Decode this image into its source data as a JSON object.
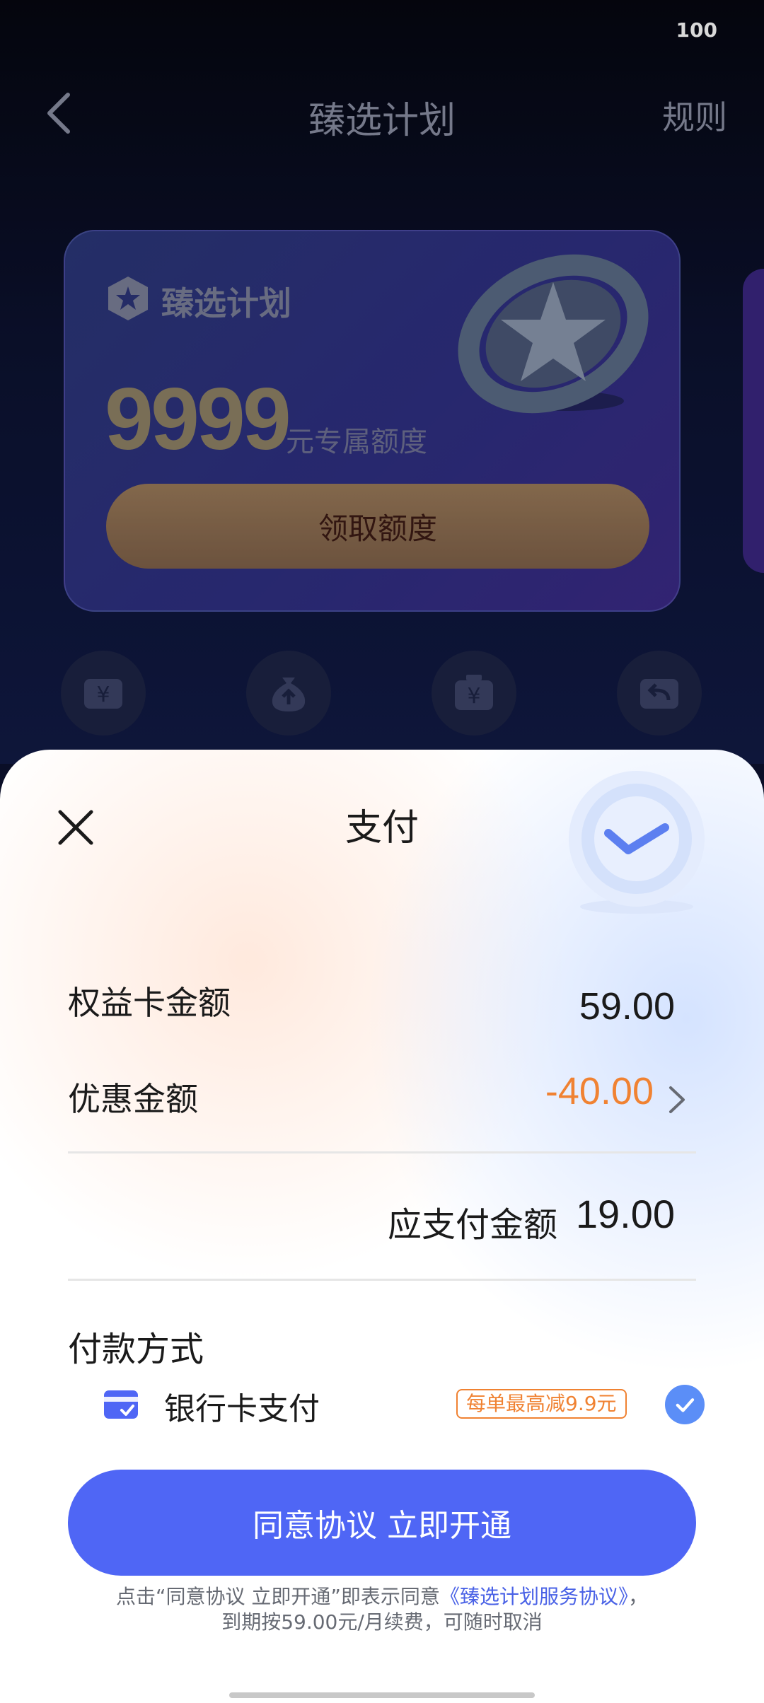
{
  "status_bar": {
    "battery": "100"
  },
  "nav": {
    "title": "臻选计划",
    "rules": "规则"
  },
  "plan_card": {
    "name": "臻选计划",
    "amount": "9999",
    "unit": "元专属额度",
    "claim_button": "领取额度"
  },
  "features": [
    {
      "icon": "yuan-icon"
    },
    {
      "icon": "money-bag-up-icon"
    },
    {
      "icon": "yuan-box-icon"
    },
    {
      "icon": "return-icon"
    }
  ],
  "payment": {
    "title": "支付",
    "card_amount_label": "权益卡金额",
    "card_amount_value": "59.00",
    "discount_label": "优惠金额",
    "discount_value": "-40.00",
    "due_label": "应支付金额",
    "due_value": "19.00",
    "method_heading": "付款方式",
    "method_label": "银行卡支付",
    "promo_badge": "每单最高减9.9元",
    "agree_button": "同意协议 立即开通",
    "note_prefix": "点击“同意协议 立即开通”即表示同意",
    "note_link": "《臻选计划服务协议》",
    "note_sep": "，",
    "note_suffix": "到期按59.00元/月续费，可随时取消"
  },
  "colors": {
    "accent": "#4f66f5",
    "discount": "#f08232",
    "check": "#5b8ef7",
    "link": "#4a62e6"
  }
}
